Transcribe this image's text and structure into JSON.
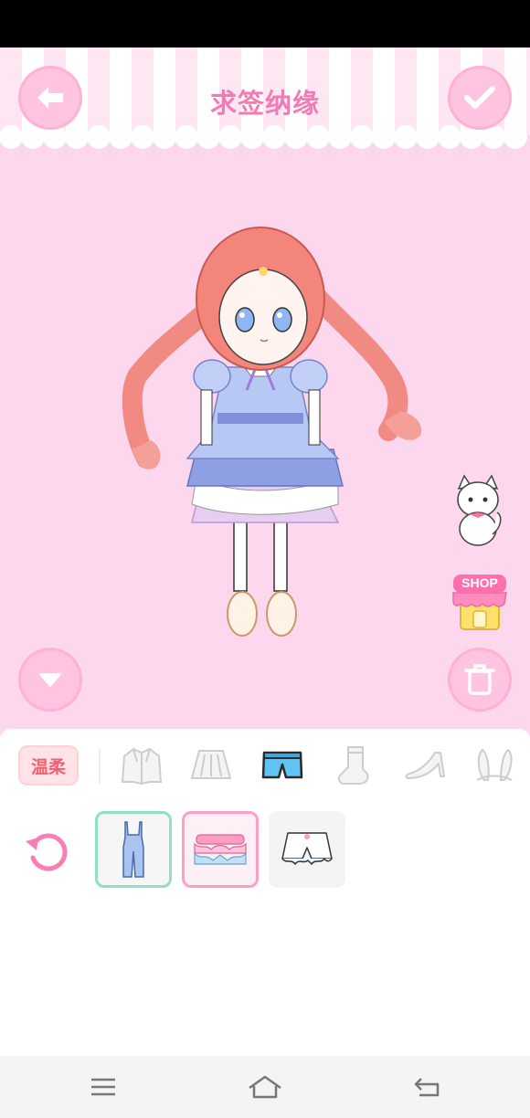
{
  "header": {
    "title": "求签纳缘",
    "back_icon": "back-arrow-icon",
    "confirm_icon": "checkmark-icon"
  },
  "scene": {
    "left_button_icon": "chevron-down-icon",
    "right_button_icon": "trash-icon",
    "pet_icon": "white-cat-icon",
    "shop_label": "SHOP"
  },
  "panel": {
    "style_tag": "温柔",
    "categories": [
      "jacket-icon",
      "skirt-icon",
      "shorts-icon",
      "sock-icon",
      "high-heel-icon",
      "bunny-ears-icon"
    ],
    "selected_category": "shorts-icon",
    "items": [
      "denim-overalls",
      "pink-ruffle-bloomers",
      "white-ruffle-shorts"
    ],
    "selected_item": "pink-ruffle-bloomers"
  },
  "colors": {
    "background": "#fcd7ee",
    "accent_pink": "#f27bb6",
    "button_pink": "#ffc4df",
    "tag_red": "#f25f71",
    "teal_border": "#8ee0c6"
  },
  "navbar": {
    "icons": [
      "menu-icon",
      "home-icon",
      "back-icon"
    ]
  }
}
